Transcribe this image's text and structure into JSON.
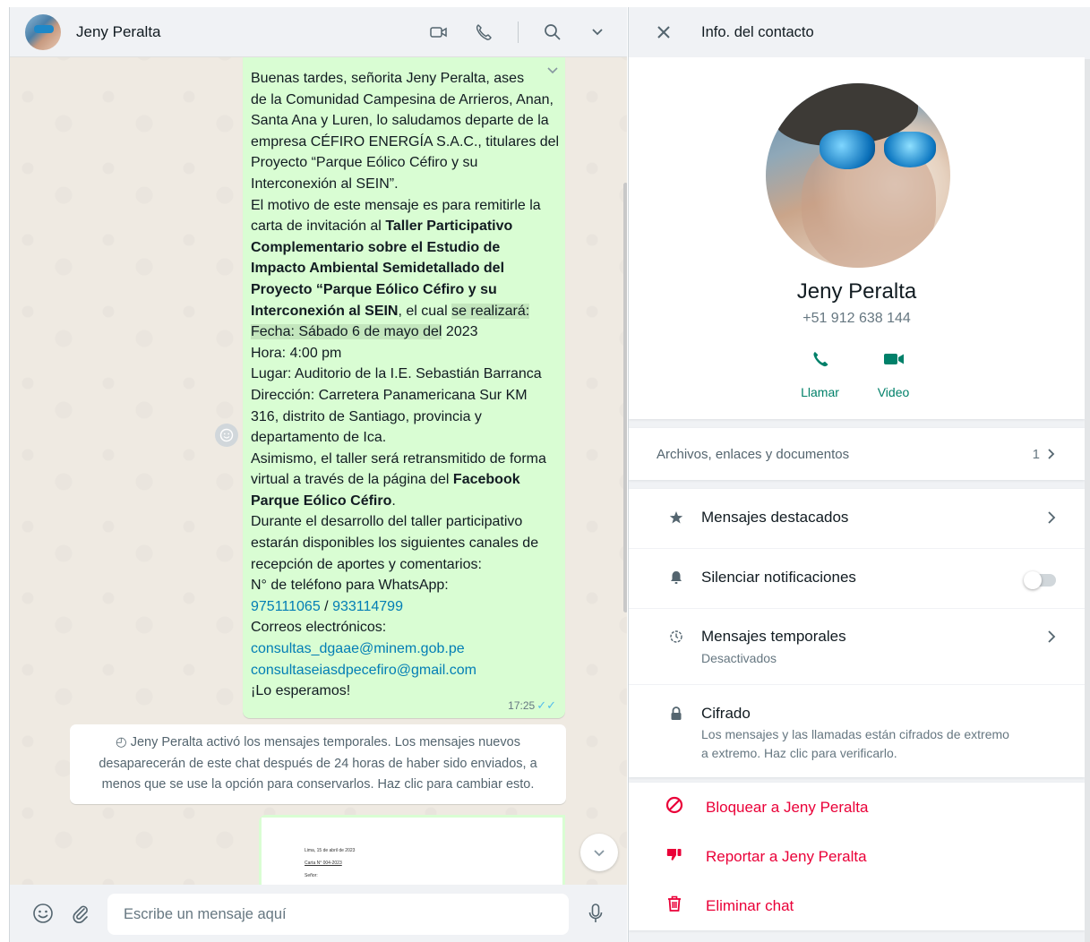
{
  "chat": {
    "contact_name": "Jeny Peralta",
    "composer_placeholder": "Escribe un mensaje aquí",
    "message": {
      "lines": [
        "Buenas tardes, señorita  Jeny Peralta, ases",
        "de la Comunidad Campesina de Arrieros, Anan,",
        "Santa Ana y Luren, lo saludamos departe de la",
        "empresa CÉFIRO ENERGÍA S.A.C., titulares del",
        "Proyecto “Parque Eólico Céfiro y su",
        "Interconexión al SEIN”.",
        "El motivo de este mensaje es para remitirle la",
        "carta de invitación al ",
        "Taller Participativo",
        "Complementario sobre el Estudio de",
        "Impacto Ambiental Semidetallado del",
        "Proyecto “Parque Eólico Céfiro y su",
        "Interconexión al SEIN",
        ", el cual ",
        "se realizará:",
        "Fecha: Sábado 6 de mayo del",
        " 2023",
        "Hora: 4:00 pm",
        "Lugar:  Auditorio de la I.E. Sebastián Barranca",
        "Dirección: Carretera Panamericana Sur KM",
        "316, distrito de Santiago, provincia y",
        "departamento de Ica.",
        "Asimismo, el taller será retransmitido de forma",
        "virtual a través de la página del ",
        "Facebook",
        "Parque Eólico Céfiro",
        ".",
        "Durante el desarrollo del taller participativo",
        "estarán disponibles los siguientes canales de",
        "recepción de aportes y comentarios:",
        "N° de teléfono para WhatsApp:",
        "975111065",
        " / ",
        "933114799",
        "Correos electrónicos:",
        "consultas_dgaae@minem.gob.pe",
        "consultaseiasdpecefiro@gmail.com",
        "¡Lo esperamos!"
      ],
      "time": "17:25"
    },
    "system_message": {
      "line1": "Jeny Peralta activó los mensajes temporales. Los mensajes nuevos",
      "line2": "desaparecerán de este chat después de 24 horas de haber sido enviados, a",
      "line3": "menos que se use la opción para conservarlos. Haz clic para cambiar esto."
    },
    "document_preview": {
      "line1": "Lima, 15 de abril de 2023",
      "line2": "Carta N° 004-2023",
      "line3": "Señor:"
    }
  },
  "info": {
    "header_title": "Info. del contacto",
    "name": "Jeny Peralta",
    "phone": "+51 912 638 144",
    "call_label": "Llamar",
    "video_label": "Video",
    "files_label": "Archivos, enlaces y documentos",
    "files_count": "1",
    "starred_label": "Mensajes destacados",
    "mute_label": "Silenciar notificaciones",
    "mute_enabled": false,
    "disappearing_label": "Mensajes temporales",
    "disappearing_status": "Desactivados",
    "encryption_label": "Cifrado",
    "encryption_sub1": "Los mensajes y las llamadas están cifrados de extremo",
    "encryption_sub2": "a extremo. Haz clic para verificarlo.",
    "block_label": "Bloquear a Jeny Peralta",
    "report_label": "Reportar a Jeny Peralta",
    "delete_label": "Eliminar chat"
  },
  "colors": {
    "accent": "#008069",
    "outgoing_bubble": "#d9fdd3",
    "danger": "#ea0038",
    "link": "#027eb5",
    "read_ticks": "#53bdeb"
  }
}
